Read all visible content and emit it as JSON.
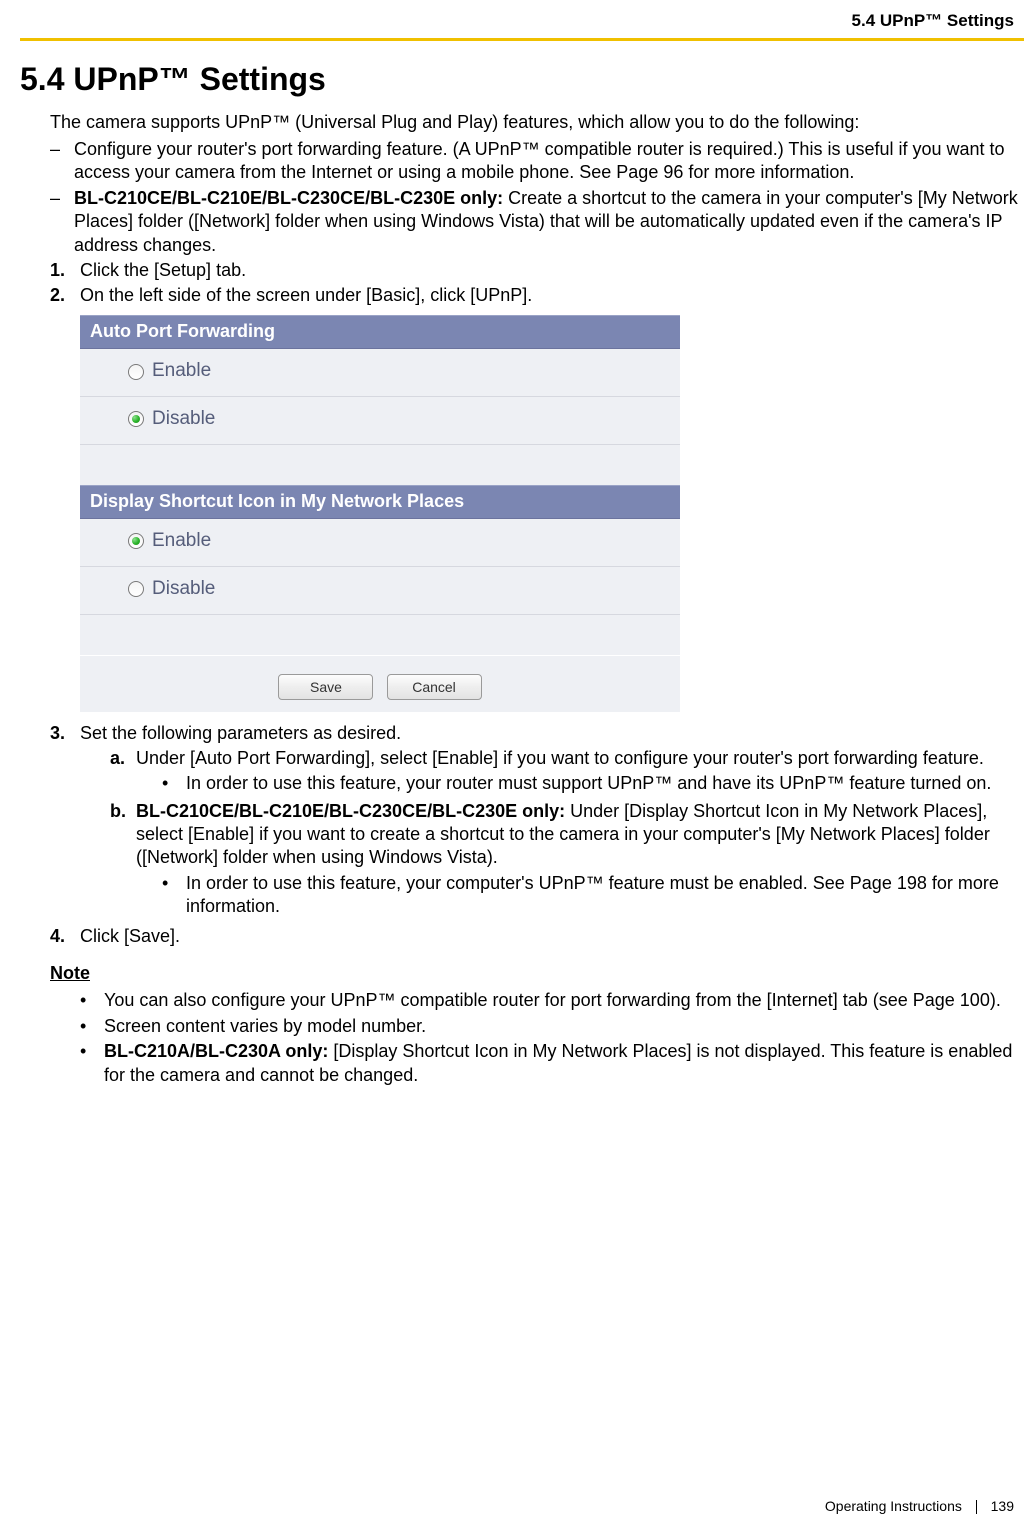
{
  "header": {
    "section_label": "5.4 UPnP™ Settings"
  },
  "heading": "5.4  UPnP™ Settings",
  "intro": "The camera supports UPnP™ (Universal Plug and Play) features, which allow you to do the following:",
  "dashes": [
    {
      "text": "Configure your router's port forwarding feature. (A UPnP™ compatible router is required.) This is useful if you want to access your camera from the Internet or using a mobile phone. See Page 96 for more information."
    },
    {
      "bold": "BL-C210CE/BL-C210E/BL-C230CE/BL-C230E only:",
      "text": " Create a shortcut to the camera in your computer's [My Network Places] folder ([Network] folder when using Windows Vista) that will be automatically updated even if the camera's IP address changes."
    }
  ],
  "steps": {
    "s1": "Click the [Setup] tab.",
    "s2": "On the left side of the screen under [Basic], click [UPnP].",
    "s3": "Set the following parameters as desired.",
    "s3a": "Under [Auto Port Forwarding], select [Enable] if you want to configure your router's port forwarding feature.",
    "s3a_bullet": "In order to use this feature, your router must support UPnP™ and have its UPnP™ feature turned on.",
    "s3b_bold": "BL-C210CE/BL-C210E/BL-C230CE/BL-C230E only:",
    "s3b": " Under [Display Shortcut Icon in My Network Places], select [Enable] if you want to create a shortcut to the camera in your computer's [My Network Places] folder ([Network] folder when using Windows Vista).",
    "s3b_bullet": "In order to use this feature, your computer's UPnP™ feature must be enabled. See Page 198 for more information.",
    "s4": "Click [Save]."
  },
  "panel": {
    "section1_title": "Auto Port Forwarding",
    "section2_title": "Display Shortcut Icon in My Network Places",
    "enable_label": "Enable",
    "disable_label": "Disable",
    "section1_selected": "disable",
    "section2_selected": "enable",
    "save_btn": "Save",
    "cancel_btn": "Cancel"
  },
  "note": {
    "heading": "Note",
    "items": [
      {
        "text": "You can also configure your UPnP™ compatible router for port forwarding from the [Internet] tab (see Page 100)."
      },
      {
        "text": "Screen content varies by model number."
      },
      {
        "bold": "BL-C210A/BL-C230A only:",
        "text": " [Display Shortcut Icon in My Network Places] is not displayed. This feature is enabled for the camera and cannot be changed."
      }
    ]
  },
  "footer": {
    "doc_title": "Operating Instructions",
    "page_number": "139"
  }
}
